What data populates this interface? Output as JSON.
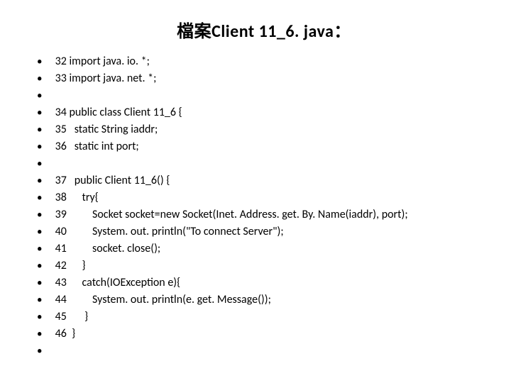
{
  "title": "檔案Client 11_6. java：",
  "lines": [
    " 32 import java. io. *;",
    " 33 import java. net. *;",
    "",
    " 34 public class Client 11_6 {",
    " 35   static String iaddr;",
    " 36   static int port;",
    "",
    " 37   public Client 11_6() {",
    " 38      try{",
    " 39          Socket socket=new Socket(Inet. Address. get. By. Name(iaddr), port);",
    " 40          System. out. println(\"To connect Server\");",
    " 41          socket. close();",
    " 42      }",
    " 43      catch(IOException e){",
    " 44          System. out. println(e. get. Message());",
    " 45       }",
    " 46  }",
    ""
  ]
}
